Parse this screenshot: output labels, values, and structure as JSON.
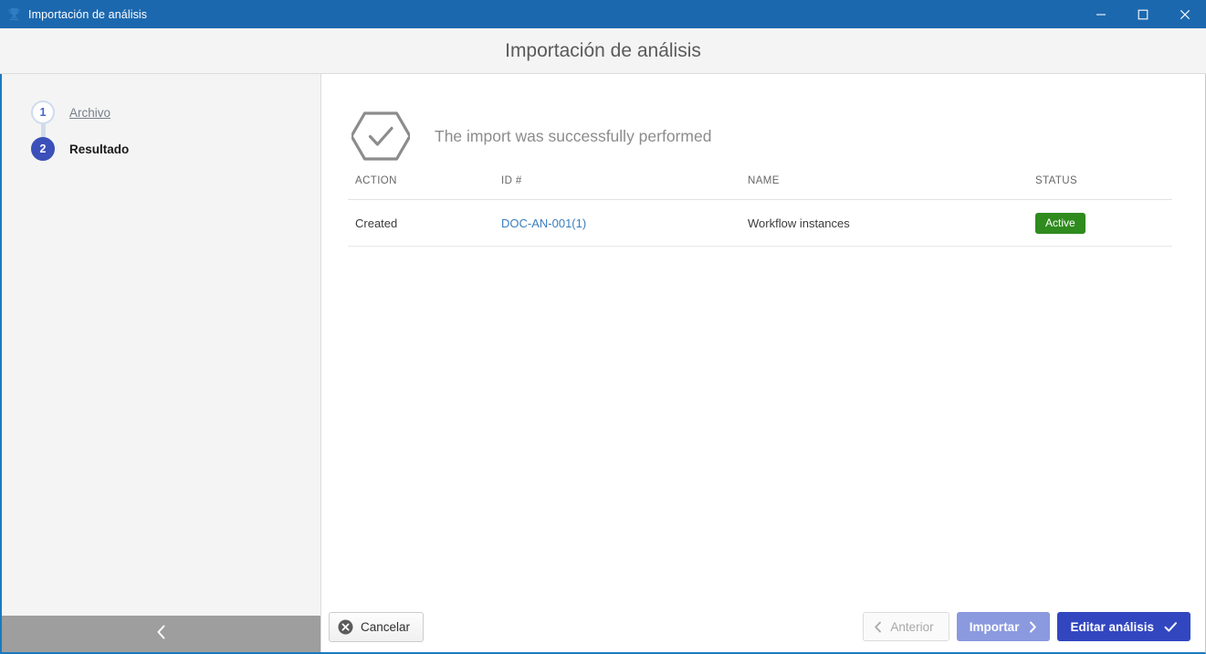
{
  "window": {
    "titlebar_title": "Importación de análisis",
    "app_icon": "trophy-icon",
    "minimize": "minimize-icon",
    "maximize": "maximize-icon",
    "close": "close-icon",
    "titlebar_color": "#1c68ae",
    "border_color": "#1c79c0"
  },
  "header": {
    "title": "Importación de análisis"
  },
  "sidebar": {
    "steps": [
      {
        "number": "1",
        "label": "Archivo",
        "state": "inactive"
      },
      {
        "number": "2",
        "label": "Resultado",
        "state": "active"
      }
    ],
    "collapse_icon": "chevron-left-icon",
    "collapse_bar_color": "#9e9e9e",
    "active_color": "#3b50b9",
    "inactive_color": "#cfdced"
  },
  "main": {
    "result": {
      "icon": "hexagon-check-icon",
      "message": "The import was successfully performed",
      "icon_color": "#8c8c8c"
    },
    "table": {
      "columns": [
        "ACTION",
        "ID #",
        "NAME",
        "STATUS"
      ],
      "rows": [
        {
          "action": "Created",
          "id": "DOC-AN-001(1)",
          "name": "Workflow instances",
          "status": "Active",
          "status_color": "#2f8b1e",
          "id_link_color": "#3b7dbf"
        }
      ]
    }
  },
  "footer": {
    "cancel": {
      "label": "Cancelar",
      "icon": "circle-x-icon"
    },
    "previous": {
      "label": "Anterior",
      "icon": "chevron-left-icon",
      "disabled": true
    },
    "import": {
      "label": "Importar",
      "icon": "chevron-right-icon",
      "color": "#8b99df"
    },
    "edit": {
      "label": "Editar análisis",
      "icon": "check-icon",
      "color": "#3246c0"
    }
  }
}
